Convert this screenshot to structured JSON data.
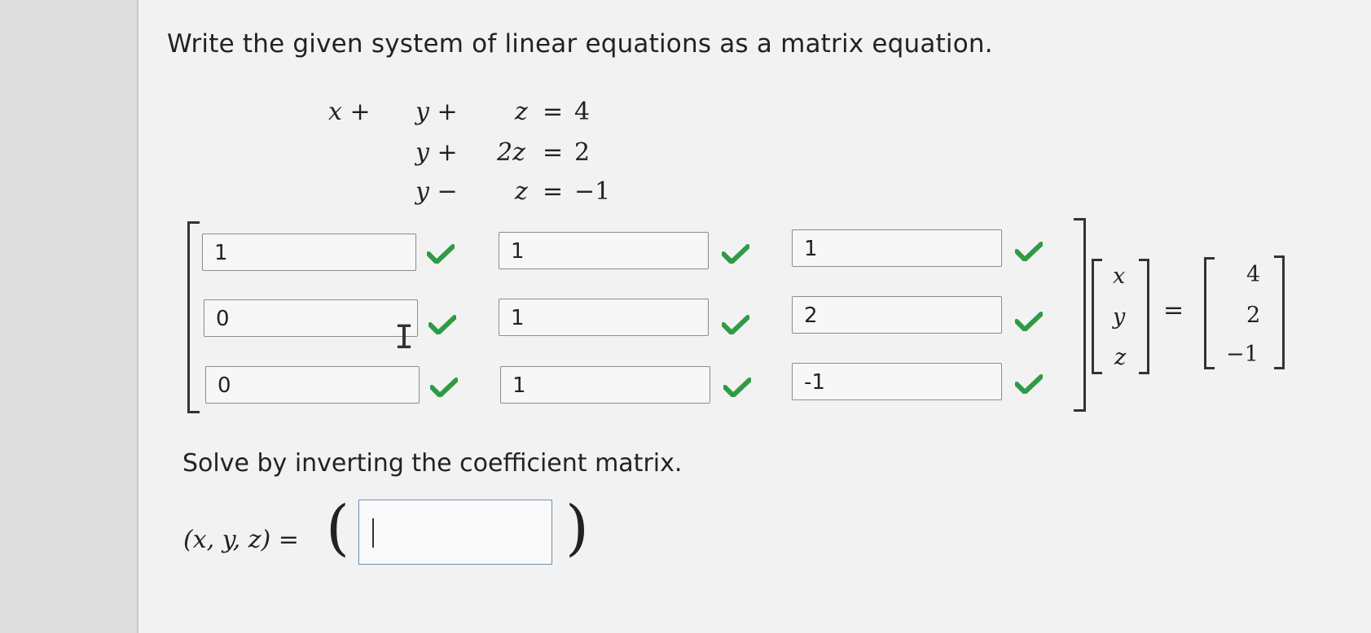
{
  "prompt": "Write the given system of linear equations as a matrix equation.",
  "system": {
    "row1": {
      "a": "x +",
      "b": "y +",
      "c": "z",
      "eq": "=",
      "rhs": "4"
    },
    "row2": {
      "b": "y +",
      "c": "2z",
      "eq": "=",
      "rhs": "2"
    },
    "row3": {
      "b": "y −",
      "c": "z",
      "eq": "=",
      "rhs": "−1"
    }
  },
  "matrix": {
    "cells": [
      [
        "1",
        "1",
        "1"
      ],
      [
        "0",
        "1",
        "2"
      ],
      [
        "0",
        "1",
        "-1"
      ]
    ],
    "status": "correct",
    "check_color": "#2e9b46"
  },
  "vector": {
    "x": "x",
    "y": "y",
    "z": "z"
  },
  "equals": "=",
  "constants": [
    "4",
    "2",
    "−1"
  ],
  "solve_prompt": "Solve by inverting the coefficient matrix.",
  "answer": {
    "label": "(x, y, z) =",
    "value": ""
  },
  "accent_colors": {
    "input_border": "#6f8fb0",
    "check": "#2e9b46"
  }
}
